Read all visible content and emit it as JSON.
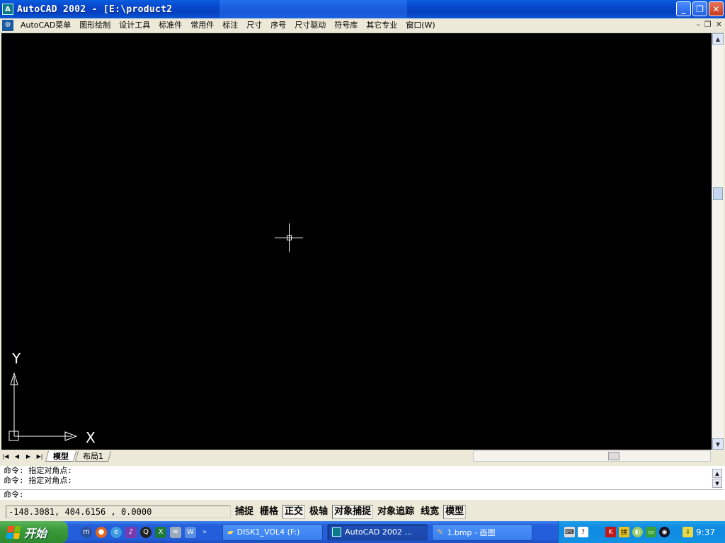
{
  "window": {
    "title": "AutoCAD 2002 - [E:\\product2",
    "app_icon": "autocad-icon",
    "buttons": {
      "minimize": "_",
      "restore": "❐",
      "close": "✕"
    }
  },
  "menu": {
    "items": [
      "AutoCAD菜单",
      "图形绘制",
      "设计工具",
      "标准件",
      "常用件",
      "标注",
      "尺寸",
      "序号",
      "尺寸驱动",
      "符号库",
      "其它专业",
      "窗口(W)"
    ],
    "mdi": {
      "minimize": "–",
      "restore": "❐",
      "close": "✕"
    }
  },
  "ucs": {
    "x_label": "X",
    "y_label": "Y"
  },
  "tabs": {
    "nav": [
      "|◀",
      "◀",
      "▶",
      "▶|"
    ],
    "items": [
      {
        "label": "模型",
        "active": true
      },
      {
        "label": "布局1",
        "active": false
      }
    ]
  },
  "command": {
    "history": [
      "命令: 指定对角点:",
      "命令: 指定对角点:"
    ],
    "prompt": "命令:"
  },
  "status": {
    "coords": "-148.3081, 404.6156 , 0.0000",
    "toggles": [
      {
        "label": "捕捉",
        "on": false
      },
      {
        "label": "栅格",
        "on": false
      },
      {
        "label": "正交",
        "on": true
      },
      {
        "label": "极轴",
        "on": false
      },
      {
        "label": "对象捕捉",
        "on": true
      },
      {
        "label": "对象追踪",
        "on": false
      },
      {
        "label": "线宽",
        "on": false
      },
      {
        "label": "模型",
        "on": true
      }
    ]
  },
  "taskbar": {
    "start_label": "开始",
    "quick_launch": [
      "maxthon-icon",
      "firefox-icon",
      "browser-icon",
      "media-icon",
      "qq-icon",
      "excel-icon",
      "word-icon",
      "notepad-icon"
    ],
    "tasks": [
      {
        "label": "DISK1_VOL4 (F:)",
        "icon": "folder-icon",
        "active": false
      },
      {
        "label": "AutoCAD 2002 ...",
        "icon": "autocad-icon",
        "active": true
      },
      {
        "label": "1.bmp - 画图",
        "icon": "paint-icon",
        "active": false
      }
    ],
    "tray_icons": [
      "keyboard-icon",
      "help-icon",
      "kaspersky-icon",
      "ime-icon",
      "sound-icon",
      "network-icon",
      "security-icon",
      "update-icon"
    ],
    "clock": "9:37"
  },
  "colors": {
    "canvas": "#000000",
    "titlebar": "#0845c8",
    "taskbar": "#245edb",
    "start": "#3a9a3a"
  }
}
